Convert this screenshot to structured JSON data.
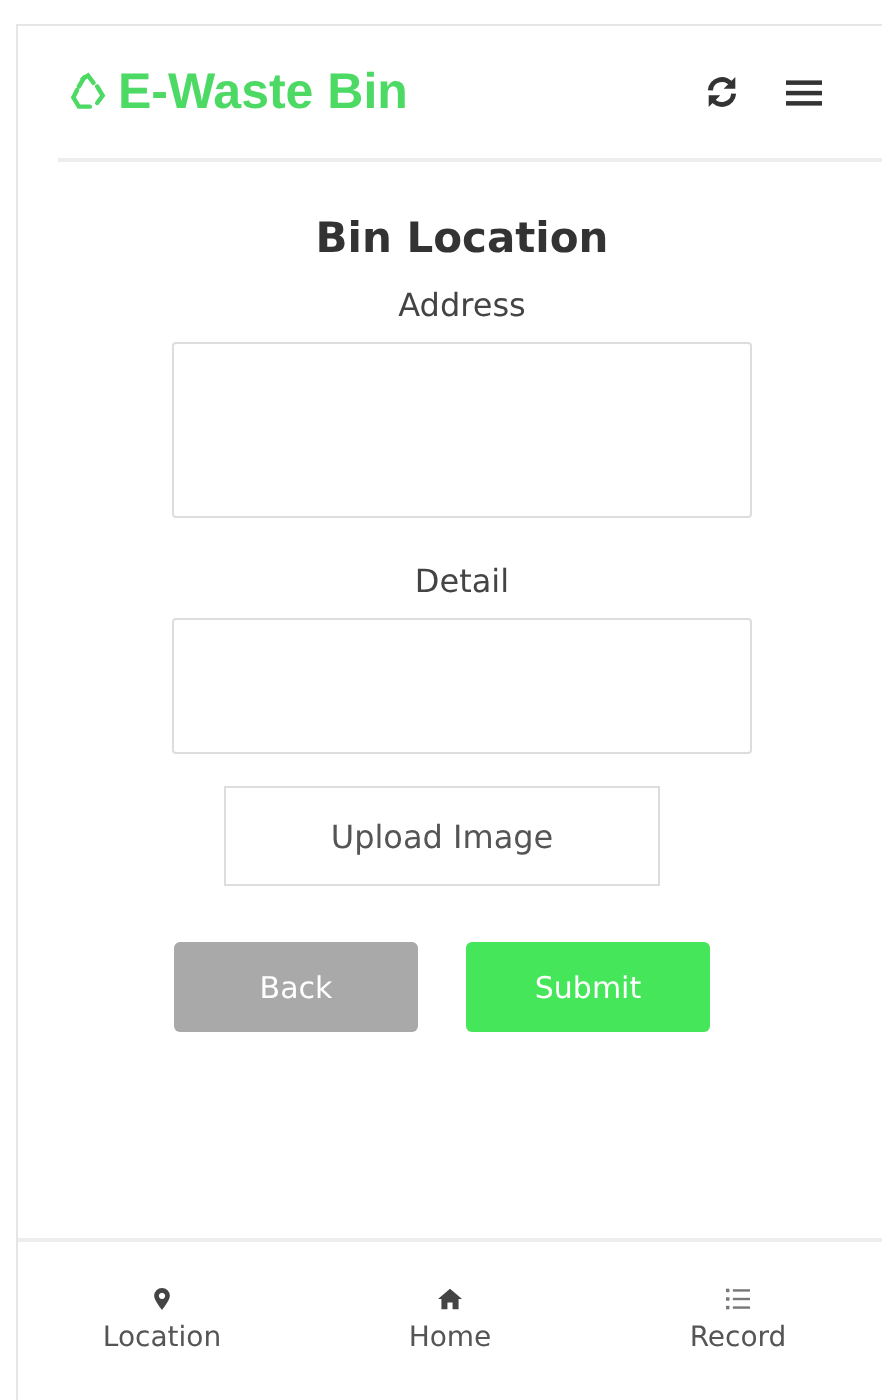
{
  "header": {
    "title": "E-Waste Bin"
  },
  "form": {
    "title": "Bin Location",
    "fields": [
      {
        "label": "Address",
        "kind": "tall"
      },
      {
        "label": "Detail",
        "kind": "short"
      }
    ],
    "upload": "Upload Image",
    "buttons": [
      {
        "label": "Back",
        "kind": "secondary",
        "disabled": true
      },
      {
        "label": "Submit",
        "kind": "primary",
        "disabled": false
      }
    ]
  },
  "nav": [
    {
      "label": "Location",
      "kind": "pin"
    },
    {
      "label": "Home",
      "kind": "home"
    },
    {
      "label": "Record",
      "kind": "list"
    }
  ]
}
